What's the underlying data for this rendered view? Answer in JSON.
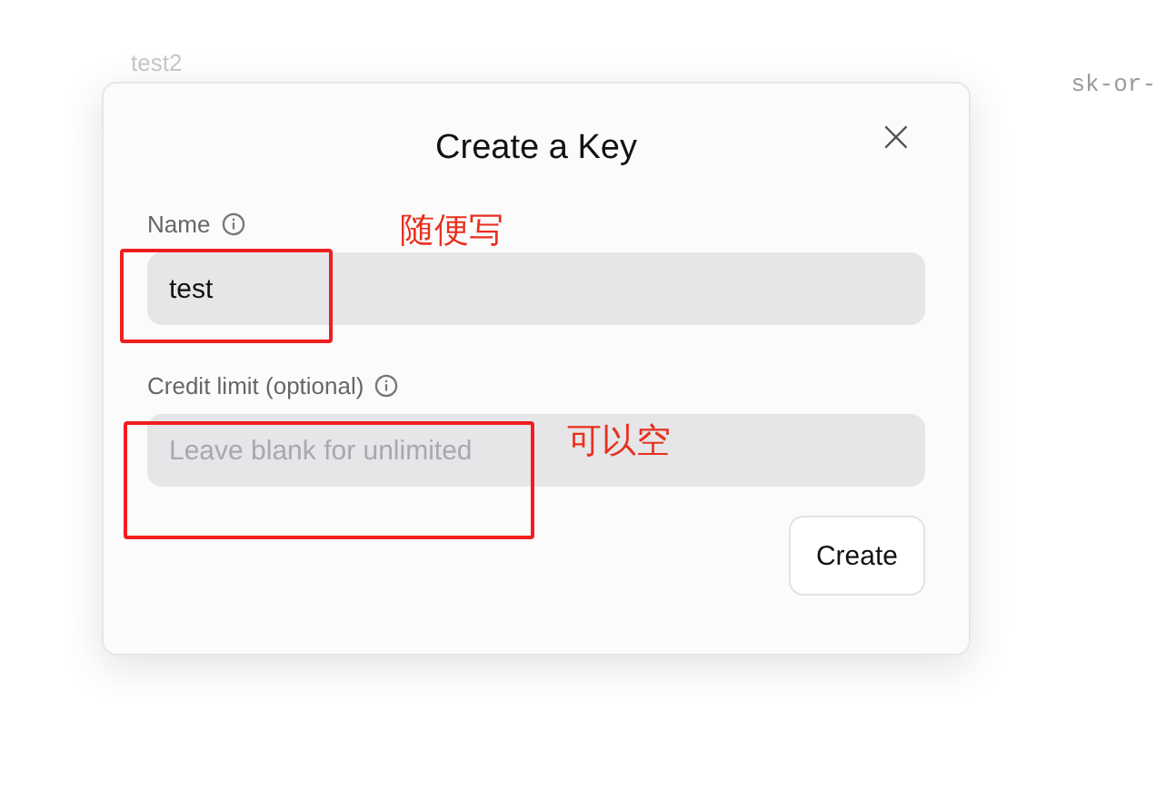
{
  "background": {
    "row_name": "test2",
    "row_key": "sk-or-"
  },
  "dialog": {
    "title": "Create a Key",
    "close": "×",
    "fields": [
      {
        "label": "Name",
        "value": "test"
      },
      {
        "label": "Credit limit (optional)",
        "placeholder": "Leave blank for unlimited"
      }
    ],
    "button": "Create"
  },
  "annotations": [
    {
      "note": "随便写"
    },
    {
      "note": "可以空"
    }
  ]
}
